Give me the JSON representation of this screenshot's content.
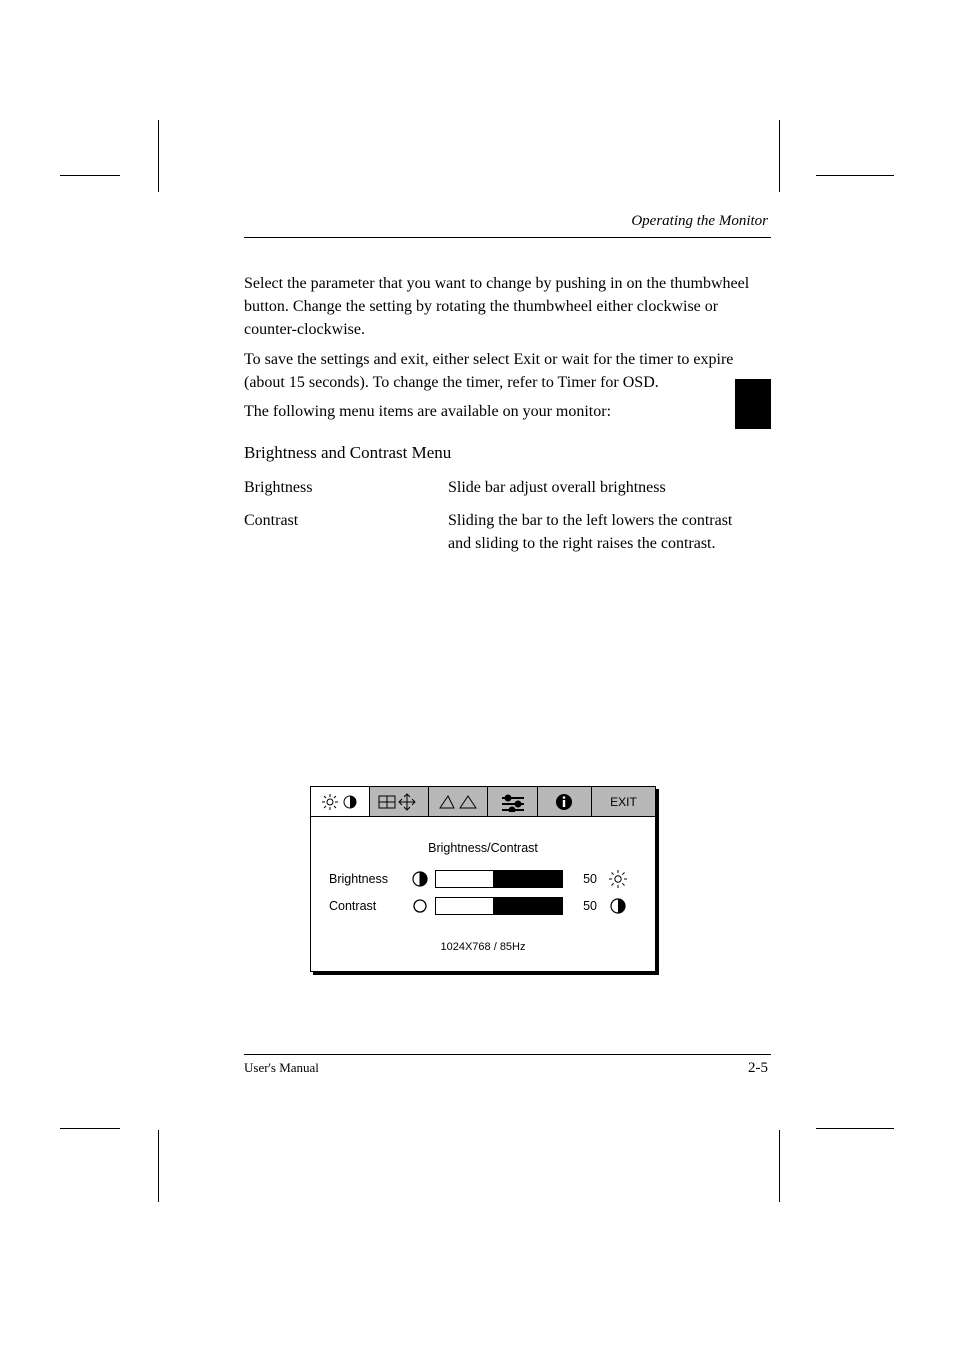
{
  "header": {
    "breadcrumb": "Operating the Monitor"
  },
  "paragraphs": {
    "intro1": "Select the parameter that you want to change by pushing in on the thumbwheel button. Change the setting by rotating the thumbwheel either clockwise or counter-clockwise.",
    "intro2": "To save the settings and exit, either select Exit or wait for the timer to expire (about 15 seconds). To change the timer, refer to Timer for OSD.",
    "intro3": "The following menu items are available on your monitor:",
    "bc_title": "Brightness and Contrast Menu",
    "bc_brightness_label": "Brightness",
    "bc_brightness_desc": "Slide bar adjust overall brightness",
    "bc_contrast_label": "Contrast",
    "bc_contrast_desc": "Sliding the bar to the left lowers the contrast and sliding to the right raises the contrast."
  },
  "osd": {
    "exit_label": "EXIT",
    "title": "Brightness/Contrast",
    "rows": [
      {
        "label": "Brightness",
        "value": 50
      },
      {
        "label": "Contrast",
        "value": 50
      }
    ],
    "footer": "1024X768 / 85Hz"
  },
  "footer": {
    "manual": "User's Manual",
    "page": "2-5"
  },
  "icons": {
    "brightness": "brightness-icon",
    "contrast": "contrast-icon",
    "size": "size-icon",
    "geometry": "geometry-icon",
    "settings": "settings-icon",
    "info": "info-icon",
    "brightness_small": "brightness-small-icon",
    "circle_empty": "circle-empty-icon",
    "brightness_outline": "brightness-outline-icon",
    "contrast_half": "contrast-half-icon"
  },
  "chart_data": {
    "type": "bar",
    "title": "Brightness/Contrast",
    "categories": [
      "Brightness",
      "Contrast"
    ],
    "values": [
      50,
      50
    ],
    "xlabel": "",
    "ylabel": "",
    "ylim": [
      0,
      100
    ]
  }
}
